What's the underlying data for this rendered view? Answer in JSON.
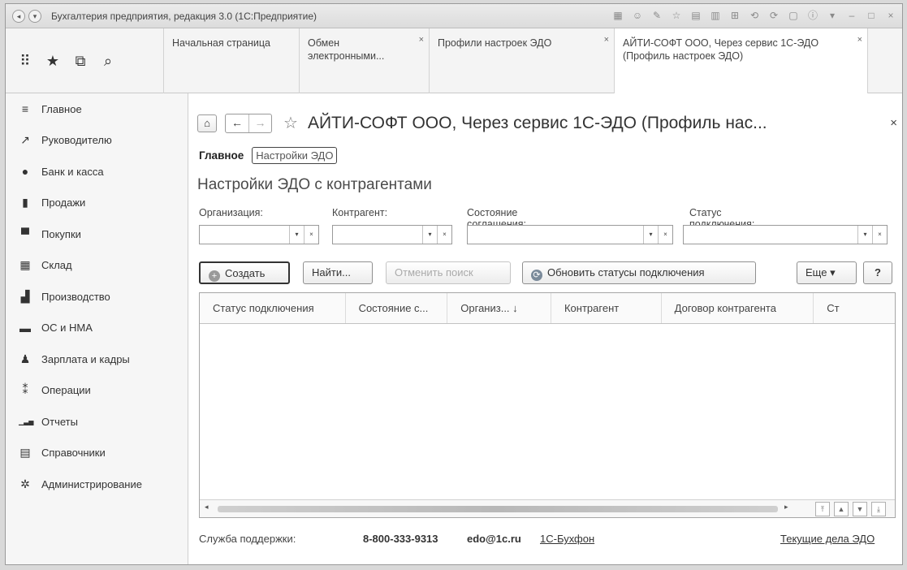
{
  "window": {
    "title": "Бухгалтерия предприятия, редакция 3.0 (1С:Предприятие)",
    "sys_left": "◂",
    "sys_menu": "▾",
    "right_icons": [
      "▦",
      "☺",
      "✎",
      "☆",
      "▤",
      "▥",
      "⊞",
      "⟲",
      "⟳",
      "▢",
      "ⓘ",
      "▾",
      "–",
      "□",
      "×"
    ]
  },
  "tools": [
    "apps-grid-icon",
    "favorites-icon",
    "history-icon",
    "search-icon"
  ],
  "tabs": [
    {
      "label": "Начальная страница",
      "closable": false
    },
    {
      "label": "Обмен электронными...",
      "closable": true
    },
    {
      "label": "Профили настроек ЭДО",
      "closable": true
    },
    {
      "label": "АЙТИ-СОФТ ООО, Через сервис 1С-ЭДО (Профиль настроек ЭДО)",
      "closable": true
    }
  ],
  "nav": [
    {
      "label": "Главное",
      "icon": "≡",
      "name": "menu"
    },
    {
      "label": "Руководителю",
      "icon": "↗",
      "name": "chart-line"
    },
    {
      "label": "Банк и касса",
      "icon": "●",
      "name": "coin"
    },
    {
      "label": "Продажи",
      "icon": "▮",
      "name": "bag"
    },
    {
      "label": "Покупки",
      "icon": "▀",
      "name": "cart"
    },
    {
      "label": "Склад",
      "icon": "▦",
      "name": "warehouse"
    },
    {
      "label": "Производство",
      "icon": "▟",
      "name": "factory"
    },
    {
      "label": "ОС и НМА",
      "icon": "▬",
      "name": "truck"
    },
    {
      "label": "Зарплата и кадры",
      "icon": "♟",
      "name": "person"
    },
    {
      "label": "Операции",
      "icon": "⁑",
      "name": "operations"
    },
    {
      "label": "Отчеты",
      "icon": "▁▃▅",
      "name": "bar-chart"
    },
    {
      "label": "Справочники",
      "icon": "▤",
      "name": "book"
    },
    {
      "label": "Администрирование",
      "icon": "✲",
      "name": "gear"
    }
  ],
  "form": {
    "home_icon": "⌂",
    "back_icon": "←",
    "forward_icon": "→",
    "star_icon": "☆",
    "close_icon": "×",
    "title": "АЙТИ-СОФТ ООО, Через сервис 1С-ЭДО (Профиль нас...",
    "section_main": "Главное",
    "section_edo": "Настройки ЭДО",
    "subtitle": "Настройки ЭДО с контрагентами"
  },
  "filters": [
    {
      "label": "Организация:",
      "value": ""
    },
    {
      "label": "Контрагент:",
      "value": ""
    },
    {
      "label": "Состояние соглашения:",
      "value": ""
    },
    {
      "label": "Статус подключения:",
      "value": ""
    }
  ],
  "filter_dropdown_glyph": "▾",
  "filter_clear_glyph": "×",
  "commands": {
    "create": "Создать",
    "create_icon": "+",
    "find": "Найти...",
    "cancel_search": "Отменить поиск",
    "refresh": "Обновить статусы подключения",
    "refresh_icon": "⟳",
    "more": "Еще ▾",
    "help": "?"
  },
  "grid": {
    "columns": [
      "Статус подключения",
      "Состояние с...",
      "Организ...  ↓",
      "Контрагент",
      "Договор контрагента",
      "Ст"
    ],
    "rows": [],
    "scroll_left": "◂",
    "scroll_right": "▸",
    "nav_buttons": [
      "⤒",
      "▲",
      "▼",
      "⤓"
    ]
  },
  "footer": {
    "support_label": "Служба поддержки:",
    "phone": "8-800-333-9313",
    "email": "edo@1c.ru",
    "buhphone": "1С-Бухфон",
    "current_tasks": "Текущие дела ЭДО"
  }
}
